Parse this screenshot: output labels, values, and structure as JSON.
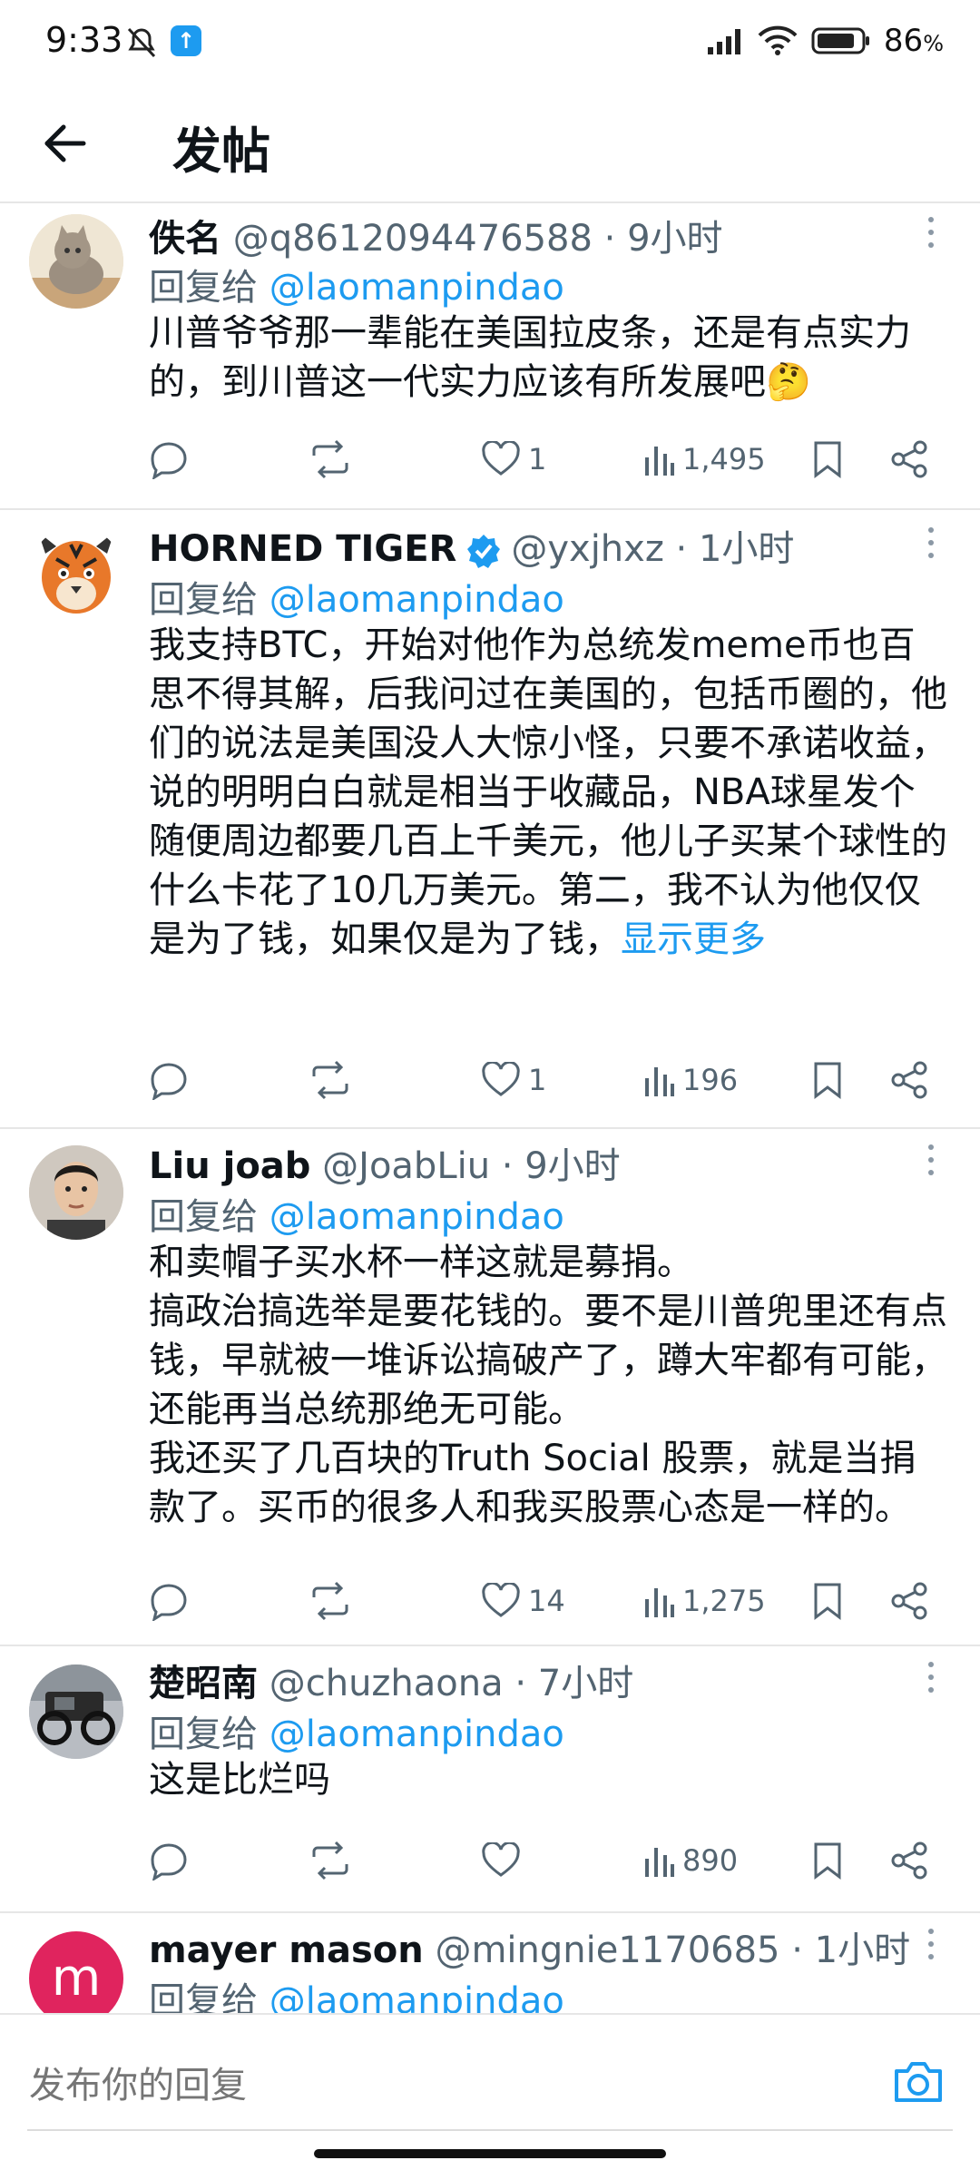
{
  "status_bar": {
    "time": "9:33",
    "battery": "86",
    "battery_unit": "%"
  },
  "header": {
    "title": "发帖"
  },
  "posts": [
    {
      "name": "佚名",
      "handle": "@q8612094476588",
      "time": "9小时",
      "reply_prefix": "回复给",
      "reply_to": "@laomanpindao",
      "text": "川普爷爷那一辈能在美国拉皮条，还是有点实力的，到川普这一代实力应该有所发展吧🤔",
      "likes": "1",
      "views": "1,495"
    },
    {
      "name": "HORNED TIGER",
      "handle": "@yxjhxz",
      "time": "1小时",
      "reply_prefix": "回复给",
      "reply_to": "@laomanpindao",
      "text": "我支持BTC，开始对他作为总统发meme币也百思不得其解，后我问过在美国的，包括币圈的，他们的说法是美国没人大惊小怪，只要不承诺收益，说的明明白白就是相当于收藏品，NBA球星发个随便周边都要几百上千美元，他儿子买某个球性的什么卡花了10几万美元。第二，我不认为他仅仅是为了钱，如果仅是为了钱，",
      "show_more": "显示更多",
      "likes": "1",
      "views": "196"
    },
    {
      "name": "Liu joab",
      "handle": "@JoabLiu",
      "time": "9小时",
      "reply_prefix": "回复给",
      "reply_to": "@laomanpindao",
      "line1": "和卖帽子买水杯一样这就是募捐。",
      "line2": "搞政治搞选举是要花钱的。要不是川普兜里还有点钱，早就被一堆诉讼搞破产了，蹲大牢都有可能，还能再当总统那绝无可能。",
      "line3": "我还买了几百块的Truth Social 股票，就是当捐款了。买币的很多人和我买股票心态是一样的。",
      "likes": "14",
      "views": "1,275"
    },
    {
      "name": "楚昭南",
      "handle": "@chuzhaona",
      "time": "7小时",
      "reply_prefix": "回复给",
      "reply_to": "@laomanpindao",
      "text": "这是比烂吗",
      "views": "890"
    },
    {
      "name": "mayer mason",
      "handle": "@mingnie1170685",
      "time": "1小时",
      "avatar_letter": "m",
      "reply_prefix": "回复给",
      "reply_to": "@laomanpindao"
    }
  ],
  "separator": "·",
  "compose": {
    "placeholder": "发布你的回复"
  },
  "colors": {
    "accent": "#1d9bf0",
    "secondary_text": "#536471",
    "avatar_pink": "#e0245e"
  }
}
